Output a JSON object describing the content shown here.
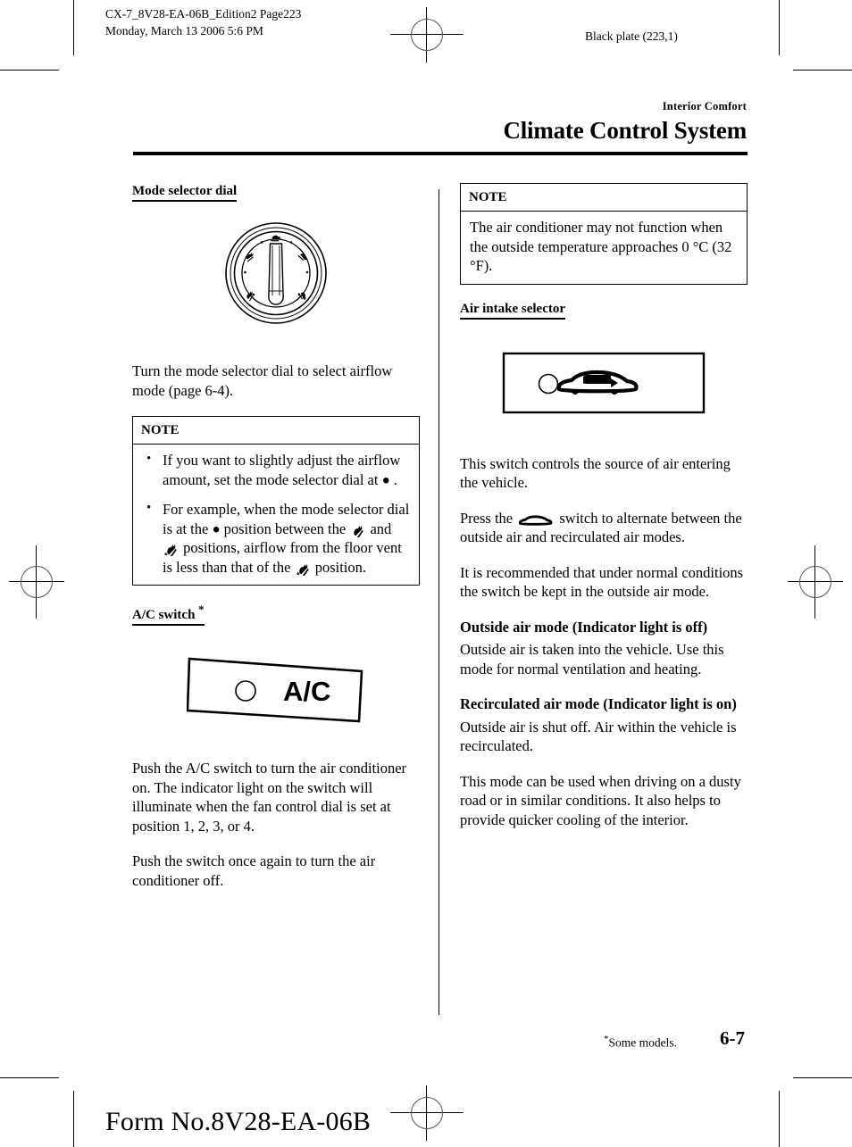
{
  "prepress": {
    "file_info": "CX-7_8V28-EA-06B_Edition2 Page223\nMonday, March 13 2006 5:6 PM",
    "black_plate": "Black plate (223,1)",
    "form_number": "Form No.8V28-EA-06B"
  },
  "running_head": {
    "kicker": "Interior Comfort",
    "title": "Climate Control System"
  },
  "left_column": {
    "mode_selector_heading": "Mode selector dial",
    "mode_selector_figure_name": "mode-selector-dial-illustration",
    "intro_paragraph": "Turn the mode selector dial to select airflow mode (page 6-4).",
    "note": {
      "title": "NOTE",
      "bullets": [
        {
          "part1": "If you want to slightly adjust the airflow amount, set the mode selector dial at",
          "icon1": "dot-position-icon",
          "part2": "."
        },
        {
          "part1": "For example, when the mode selector dial is at the",
          "icon1": "dot-position-icon",
          "part2": "position between the",
          "icon2": "floor-vent-airflow-icon",
          "part3": "and",
          "icon3": "floor-and-vent-airflow-icon",
          "part4": "positions, airflow from the floor vent is less than that of the",
          "icon4": "floor-and-vent-airflow-icon",
          "part5": "position."
        }
      ]
    },
    "ac_switch_heading": "A/C switch",
    "ac_switch_asterisk": "*",
    "ac_switch_label": "A/C",
    "ac_paragraph_1": "Push the A/C switch to turn the air conditioner on. The indicator light on the switch will illuminate when the fan control dial is set at position 1, 2, 3, or 4.",
    "ac_paragraph_2": "Push the switch once again to turn the air conditioner off."
  },
  "right_column": {
    "note": {
      "title": "NOTE",
      "text": "The air conditioner may not function when the outside temperature approaches 0 °C (32 °F)."
    },
    "air_intake_heading": "Air intake selector",
    "air_intake_figure_name": "air-intake-selector-switch-illustration",
    "paragraph_1": "This switch controls the source of air entering the vehicle.",
    "paragraph_2_part1": "Press the",
    "paragraph_2_icon": "recirculation-car-icon",
    "paragraph_2_part2": "switch to alternate between the outside air and recirculated air modes.",
    "paragraph_3": "It is recommended that under normal conditions the switch be kept in the outside air mode.",
    "outside_air_heading": "Outside air mode (Indicator light is off)",
    "outside_air_text": "Outside air is taken into the vehicle. Use this mode for normal ventilation and heating.",
    "recirculated_heading": "Recirculated air mode (Indicator light is on)",
    "recirculated_text": "Outside air is shut off. Air within the vehicle is recirculated.",
    "recirculated_text_2": "This mode can be used when driving on a dusty road or in similar conditions. It also helps to provide quicker cooling of the interior."
  },
  "footer": {
    "some_models_asterisk": "*",
    "some_models": "Some models.",
    "page_number": "6-7"
  }
}
